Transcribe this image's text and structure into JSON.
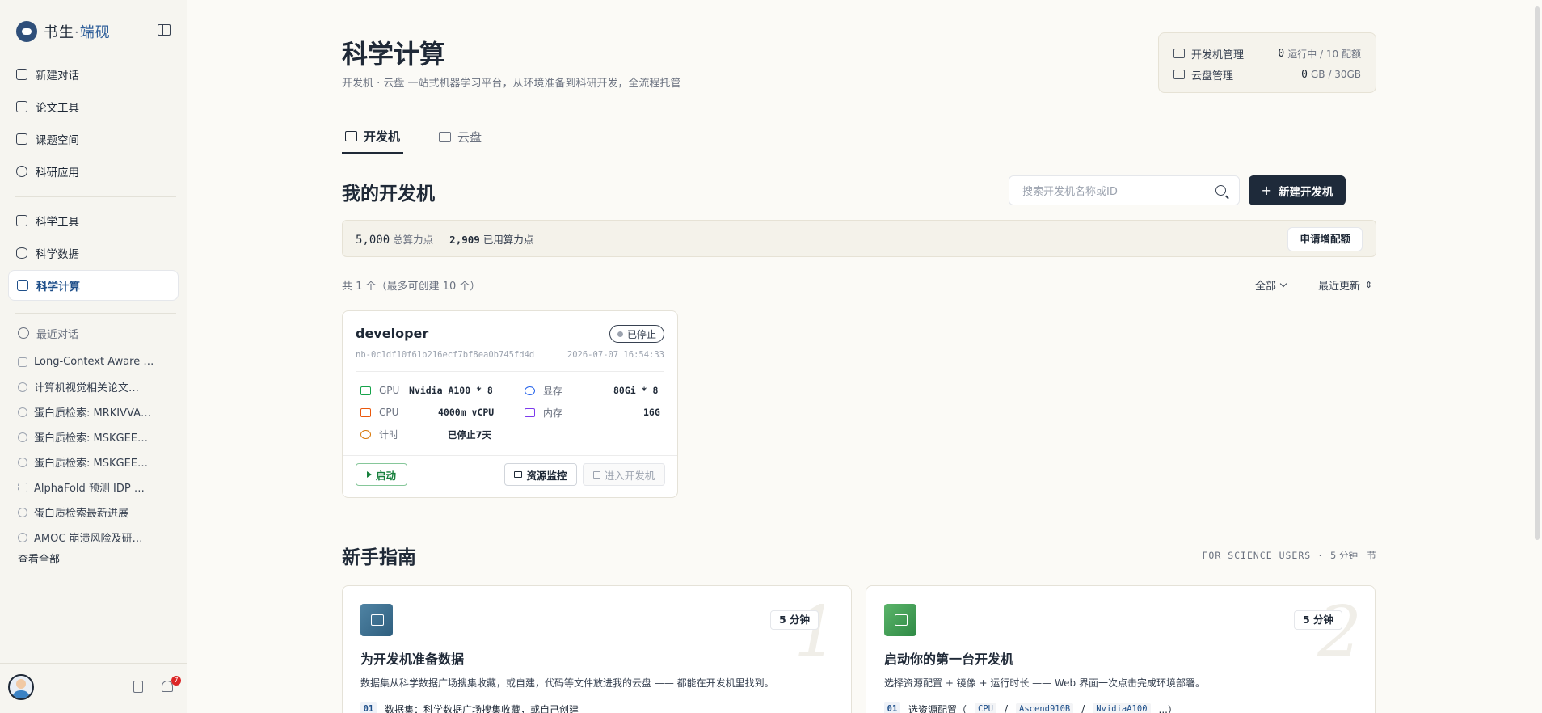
{
  "brand": {
    "name_part1": "书生",
    "dot": "·",
    "name_part2": "端砚"
  },
  "sidebar": {
    "primary": [
      {
        "label": "新建对话",
        "icon": "plus-square-icon"
      },
      {
        "label": "论文工具",
        "icon": "document-icon"
      },
      {
        "label": "课题空间",
        "icon": "library-icon"
      },
      {
        "label": "科研应用",
        "icon": "cube-icon"
      }
    ],
    "secondary": [
      {
        "label": "科学工具",
        "icon": "toolbox-icon"
      },
      {
        "label": "科学数据",
        "icon": "database-icon"
      },
      {
        "label": "科学计算",
        "icon": "monitor-icon",
        "active": true
      }
    ],
    "recent_title": "最近对话",
    "recent": [
      {
        "label": "Long-Context Aware …",
        "icon": "document-icon"
      },
      {
        "label": "计算机视觉相关论文…",
        "icon": "cube-icon"
      },
      {
        "label": "蛋白质检索: MRKIVVA…",
        "icon": "cube-icon"
      },
      {
        "label": "蛋白质检索: MSKGEE…",
        "icon": "cube-icon"
      },
      {
        "label": "蛋白质检索: MSKGEE…",
        "icon": "cube-icon"
      },
      {
        "label": "AlphaFold 预测 IDP …",
        "icon": "dashed-box-icon"
      },
      {
        "label": "蛋白质检索最新进展",
        "icon": "cube-icon"
      },
      {
        "label": "AMOC 崩溃风险及研…",
        "icon": "cube-icon"
      }
    ],
    "see_all": "查看全部",
    "notifications": "7"
  },
  "header": {
    "title": "科学计算",
    "subtitle": "开发机 · 云盘 一站式机器学习平台，从环境准备到科研开发，全流程托管"
  },
  "quota": {
    "devmachine_label": "开发机管理",
    "devmachine_value": "0",
    "devmachine_unit": "运行中 / 10 配额",
    "disk_label": "云盘管理",
    "disk_value": "0",
    "disk_unit": "GB / 30GB"
  },
  "tabs": [
    {
      "label": "开发机",
      "active": true
    },
    {
      "label": "云盘",
      "active": false
    }
  ],
  "my_machines": {
    "title": "我的开发机",
    "search_placeholder": "搜索开发机名称或ID",
    "new_button": "新建开发机",
    "total_points": "5,000",
    "total_points_label": "总算力点",
    "used_points": "2,909",
    "used_points_label": "已用算力点",
    "request_quota": "申请增配额",
    "count_text": "共 1 个（最多可创建 10 个）",
    "filter_all": "全部",
    "sort": "最近更新"
  },
  "machine": {
    "name": "developer",
    "status": "已停止",
    "id": "nb-0c1df10f61b216ecf7bf8ea0b745fd4d",
    "time": "2026-07-07 16:54:33",
    "gpu_label": "GPU",
    "gpu_value": "Nvidia A100 * 8",
    "vram_label": "显存",
    "vram_value": "80Gi * 8",
    "cpu_label": "CPU",
    "cpu_value": "4000m vCPU",
    "mem_label": "内存",
    "mem_value": "16G",
    "timer_label": "计时",
    "timer_value": "已停止7天",
    "start": "启动",
    "monitor": "资源监控",
    "enter": "进入开发机"
  },
  "guide": {
    "title": "新手指南",
    "meta_en": "FOR SCIENCE USERS",
    "meta_dot": "·",
    "meta_cn": "5 分钟一节",
    "cards": [
      {
        "num": "1",
        "minutes": "5 分钟",
        "title": "为开发机准备数据",
        "desc": "数据集从科学数据广场搜集收藏，或自建，代码等文件放进我的云盘 —— 都能在开发机里找到。",
        "step_num": "01",
        "step_text": "数据集：科学数据广场搜集收藏，或自己创建",
        "color": "#3f6f8f"
      },
      {
        "num": "2",
        "minutes": "5 分钟",
        "title": "启动你的第一台开发机",
        "desc": "选择资源配置 + 镜像 + 运行时长 —— Web 界面一次点击完成环境部署。",
        "step_num": "01",
        "step_text": "选资源配置（",
        "step_code1": "CPU",
        "step_sep1": "/",
        "step_code2": "Ascend910B",
        "step_sep2": "/",
        "step_code3": "NvidiaA100",
        "step_end": "...）",
        "color": "#3f9a4f"
      }
    ]
  }
}
